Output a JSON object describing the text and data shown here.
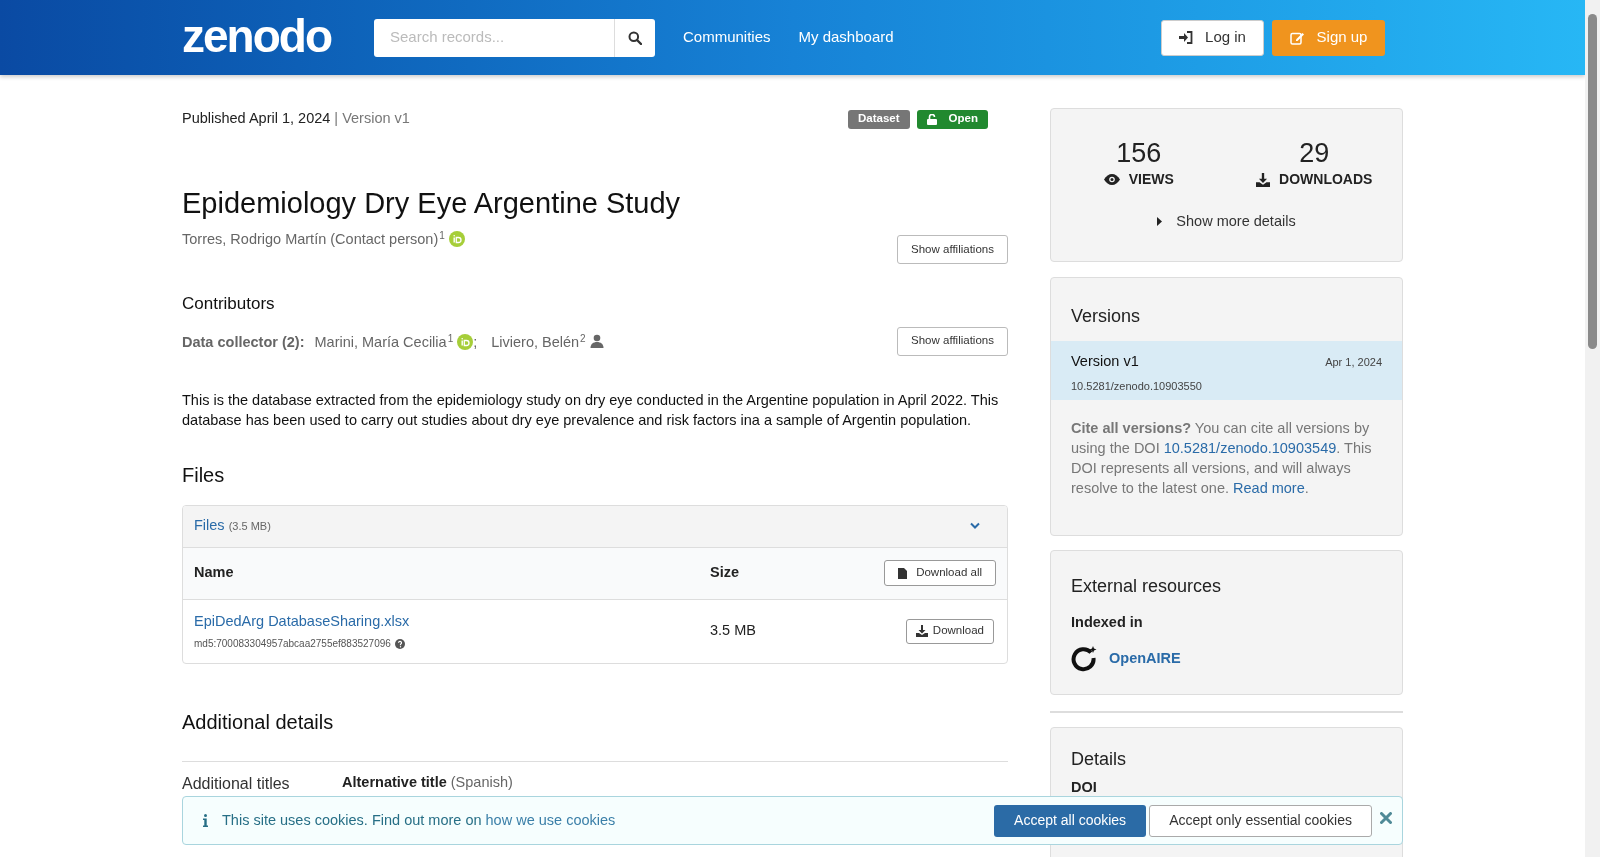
{
  "header": {
    "logo": "zenodo",
    "search": {
      "placeholder": "Search records..."
    },
    "nav": [
      "Communities",
      "My dashboard"
    ],
    "login": "Log in",
    "signup": "Sign up"
  },
  "record": {
    "published": "Published April 1, 2024",
    "separator": "|",
    "version": "Version v1",
    "badges": [
      {
        "label": "Dataset",
        "kind": "type"
      },
      {
        "label": "Open",
        "kind": "access"
      }
    ],
    "title": "Epidemiology Dry Eye Argentine Study",
    "creators": [
      {
        "name": "Torres, Rodrigo Martín (Contact person)",
        "sup": "1",
        "kind": "identified"
      }
    ],
    "show_affiliations": "Show affiliations",
    "contributors_heading": "Contributors",
    "contributor_role": "Data collector (2):",
    "contributors": [
      {
        "name": "Marini, María Cecilia",
        "sup": "1",
        "kind": "identified",
        "sep": ";"
      },
      {
        "name": "Liviero, Belén",
        "sup": "2",
        "kind": "plain"
      }
    ],
    "contributors_affiliations": "Show affiliations",
    "description": "This is the database extracted from the epidemiology study on dry eye conducted in the Argentine population in April 2022. This database has been used to carry out studies about dry eye prevalence and risk factors ina a sample of Argentin population."
  },
  "files": {
    "heading": "Files",
    "accordion": {
      "label": "Files",
      "size": "(3.5 MB)",
      "expanded": true
    },
    "columns": [
      "Name",
      "Size"
    ],
    "download_all": "Download all",
    "rows": [
      {
        "name": "EpiDedArg DatabaseSharing.xlsx",
        "checksum": "md5:700083304957abcaa2755ef883527096",
        "size": "3.5 MB",
        "action": "Download"
      }
    ]
  },
  "additional": {
    "heading": "Additional details",
    "label": "Additional titles",
    "item_label": "Alternative title",
    "item_lang": "(Spanish)"
  },
  "stats": {
    "views": "156",
    "views_label": "VIEWS",
    "downloads": "29",
    "downloads_label": "DOWNLOADS",
    "more": "Show more details"
  },
  "versions": {
    "heading": "Versions",
    "items": [
      {
        "label": "Version v1",
        "date": "Apr 1, 2024",
        "doi": "10.5281/zenodo.10903550",
        "selected": true
      }
    ],
    "cite": "**Cite all versions?** You can cite all versions by using the DOI",
    "cite_doi": "10.5281/zenodo.10903549",
    "cite_rest": ". This DOI represents all versions, and will always resolve to the latest one.",
    "read_more": "Read more",
    "end": "."
  },
  "external": {
    "heading": "External resources",
    "indexed": "Indexed in",
    "items": [
      "OpenAIRE"
    ]
  },
  "details": {
    "heading": "Details",
    "fields": [
      "DOI"
    ]
  },
  "cookies": {
    "text": "This site uses cookies. Find out more on",
    "link": "how we use cookies",
    "accept_all": "Accept all cookies",
    "accept_essential": "Accept only essential cookies"
  }
}
